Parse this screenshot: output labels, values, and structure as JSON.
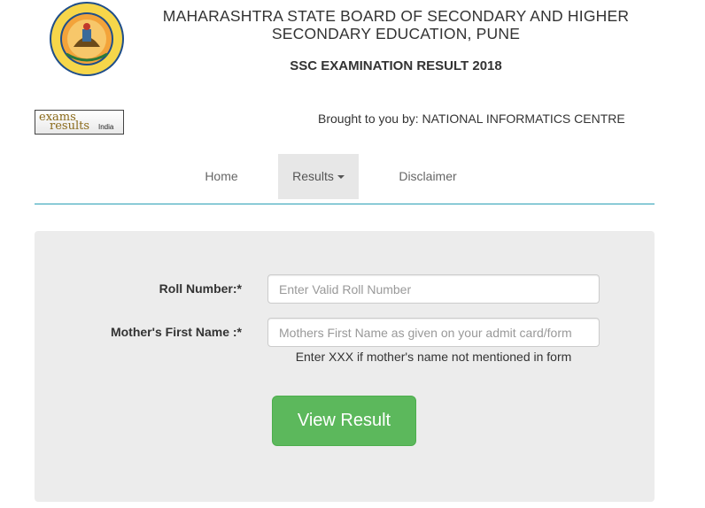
{
  "header": {
    "title_line1": "MAHARASHTRA STATE BOARD OF SECONDARY AND HIGHER",
    "title_line2": "SECONDARY EDUCATION, PUNE",
    "subtitle": "SSC EXAMINATION RESULT 2018",
    "brought_by": "Brought to you by: NATIONAL INFORMATICS CENTRE"
  },
  "exams_logo": {
    "line1": "exams",
    "line2": "results",
    "line3": "India"
  },
  "nav": {
    "items": [
      {
        "label": "Home"
      },
      {
        "label": "Results"
      },
      {
        "label": "Disclaimer"
      }
    ]
  },
  "form": {
    "roll_label": "Roll Number:*",
    "roll_placeholder": "Enter Valid Roll Number",
    "roll_value": "",
    "mother_label": "Mother's First Name :*",
    "mother_placeholder": "Mothers First Name as given on your admit card/form",
    "mother_value": "",
    "mother_help": "Enter XXX if mother's name not mentioned in form",
    "submit_label": "View Result"
  },
  "colors": {
    "accent_line": "#2aa0b5",
    "button": "#5cb85c",
    "panel": "#ececec"
  },
  "icons": {
    "logo": "board-seal-icon",
    "caret": "caret-down-icon"
  }
}
